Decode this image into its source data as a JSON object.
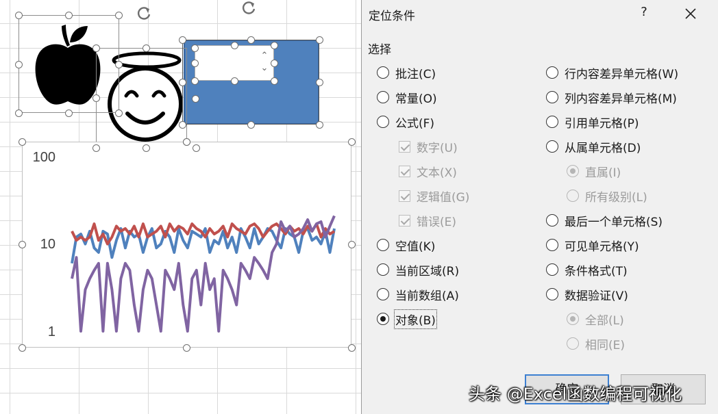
{
  "dialog": {
    "title": "定位条件",
    "help": "?",
    "group_label": "选择",
    "left_options": [
      {
        "label": "批注(C)",
        "type": "radio",
        "selected": false,
        "disabled": false
      },
      {
        "label": "常量(O)",
        "type": "radio",
        "selected": false,
        "disabled": false
      },
      {
        "label": "公式(F)",
        "type": "radio",
        "selected": false,
        "disabled": false
      },
      {
        "label": "数字(U)",
        "type": "checkbox",
        "checked": true,
        "disabled": true
      },
      {
        "label": "文本(X)",
        "type": "checkbox",
        "checked": true,
        "disabled": true
      },
      {
        "label": "逻辑值(G)",
        "type": "checkbox",
        "checked": true,
        "disabled": true
      },
      {
        "label": "错误(E)",
        "type": "checkbox",
        "checked": true,
        "disabled": true
      },
      {
        "label": "空值(K)",
        "type": "radio",
        "selected": false,
        "disabled": false
      },
      {
        "label": "当前区域(R)",
        "type": "radio",
        "selected": false,
        "disabled": false
      },
      {
        "label": "当前数组(A)",
        "type": "radio",
        "selected": false,
        "disabled": false
      },
      {
        "label": "对象(B)",
        "type": "radio",
        "selected": true,
        "disabled": false
      }
    ],
    "right_options": [
      {
        "label": "行内容差异单元格(W)",
        "type": "radio",
        "selected": false,
        "disabled": false
      },
      {
        "label": "列内容差异单元格(M)",
        "type": "radio",
        "selected": false,
        "disabled": false
      },
      {
        "label": "引用单元格(P)",
        "type": "radio",
        "selected": false,
        "disabled": false
      },
      {
        "label": "从属单元格(D)",
        "type": "radio",
        "selected": false,
        "disabled": false
      },
      {
        "label": "直属(I)",
        "type": "radio",
        "selected": true,
        "disabled": true
      },
      {
        "label": "所有级别(L)",
        "type": "radio",
        "selected": false,
        "disabled": true
      },
      {
        "label": "最后一个单元格(S)",
        "type": "radio",
        "selected": false,
        "disabled": false
      },
      {
        "label": "可见单元格(Y)",
        "type": "radio",
        "selected": false,
        "disabled": false
      },
      {
        "label": "条件格式(T)",
        "type": "radio",
        "selected": false,
        "disabled": false
      },
      {
        "label": "数据验证(V)",
        "type": "radio",
        "selected": false,
        "disabled": false
      },
      {
        "label": "全部(L)",
        "type": "radio",
        "selected": true,
        "disabled": true
      },
      {
        "label": "相同(E)",
        "type": "radio",
        "selected": false,
        "disabled": true
      }
    ],
    "ok_label": "确定",
    "cancel_label": "取消"
  },
  "watermark": "头条 @Excel函数编程可视化",
  "chart_data": {
    "type": "line",
    "yscale": "log",
    "ylim": [
      1,
      100
    ],
    "yticks": [
      "100",
      "10",
      "1"
    ],
    "x": [
      1,
      2,
      3,
      4,
      5,
      6,
      7,
      8,
      9,
      10,
      11,
      12,
      13,
      14,
      15,
      16,
      17,
      18,
      19,
      20,
      21,
      22,
      23,
      24,
      25,
      26,
      27,
      28,
      29,
      30,
      31,
      32,
      33,
      34,
      35,
      36,
      37,
      38,
      39,
      40,
      41,
      42,
      43,
      44,
      45,
      46,
      47,
      48,
      49,
      50,
      51,
      52,
      53,
      54,
      55,
      56,
      57,
      58,
      59,
      60
    ],
    "series": [
      {
        "color": "#4f81bd",
        "values": [
          6,
          12,
          13,
          10,
          14,
          9,
          8,
          14,
          13,
          7,
          11,
          15,
          9,
          14,
          12,
          13,
          8,
          12,
          15,
          9,
          10,
          14,
          12,
          8,
          15,
          11,
          9,
          14,
          13,
          12,
          15,
          8,
          11,
          10,
          14,
          9,
          12,
          8,
          15,
          12,
          9,
          15,
          10,
          12,
          15,
          14,
          11,
          9,
          15,
          13,
          12,
          8,
          14,
          15,
          11,
          12,
          10,
          14,
          8,
          15
        ]
      },
      {
        "color": "#c0504d",
        "values": [
          14,
          11,
          12,
          11,
          12,
          17,
          11,
          13,
          10,
          12,
          16,
          14,
          15,
          13,
          16,
          12,
          17,
          12,
          13,
          14,
          16,
          12,
          17,
          14,
          16,
          15,
          13,
          17,
          15,
          14,
          12,
          15,
          13,
          14,
          16,
          12,
          17,
          15,
          14,
          13,
          16,
          17,
          15,
          12,
          14,
          16,
          17,
          15,
          13,
          16,
          14,
          15,
          13,
          16,
          14,
          17,
          12,
          15,
          13,
          14
        ]
      },
      {
        "color": "#8064a2",
        "values": [
          4,
          7,
          1,
          3,
          4,
          5,
          6,
          1,
          6,
          3,
          1,
          4,
          6,
          5,
          2,
          1,
          3,
          5,
          4,
          2,
          1,
          5,
          4,
          3,
          6,
          2,
          1,
          4,
          5,
          2,
          6,
          3,
          4,
          1,
          5,
          4,
          3,
          2,
          6,
          5,
          4,
          7,
          6,
          5,
          4,
          8,
          10,
          18,
          14,
          16,
          12,
          13,
          15,
          19,
          14,
          17,
          18,
          12,
          16,
          21
        ]
      }
    ]
  }
}
